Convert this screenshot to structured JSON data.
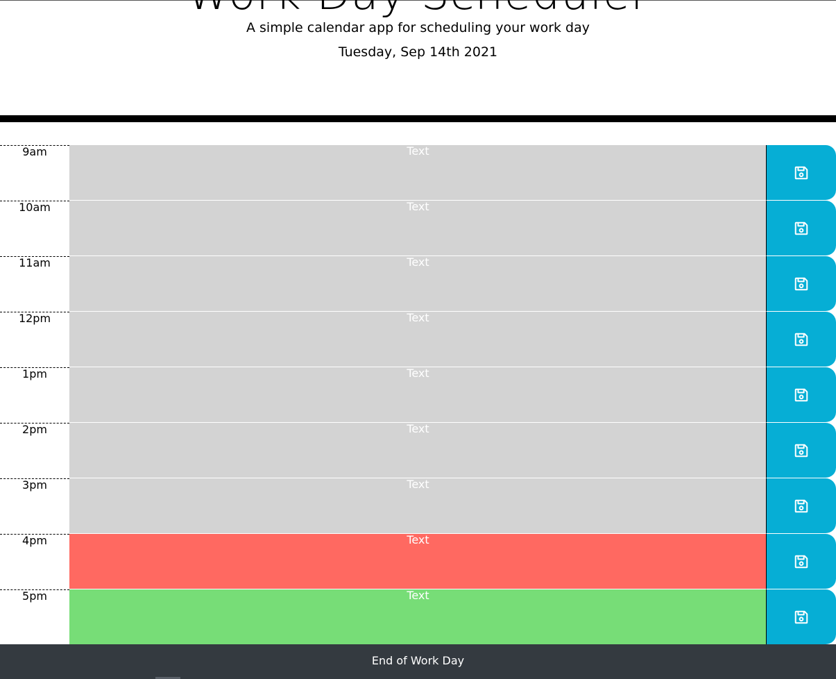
{
  "header": {
    "title": "Work Day Scheduler",
    "lead": "A simple calendar app for scheduling your work day",
    "current_day": "Tuesday, Sep 14th 2021"
  },
  "timeblocks": [
    {
      "hour": "9am",
      "placeholder": "Text",
      "status": "past"
    },
    {
      "hour": "10am",
      "placeholder": "Text",
      "status": "past"
    },
    {
      "hour": "11am",
      "placeholder": "Text",
      "status": "past"
    },
    {
      "hour": "12pm",
      "placeholder": "Text",
      "status": "past"
    },
    {
      "hour": "1pm",
      "placeholder": "Text",
      "status": "past"
    },
    {
      "hour": "2pm",
      "placeholder": "Text",
      "status": "past"
    },
    {
      "hour": "3pm",
      "placeholder": "Text",
      "status": "past"
    },
    {
      "hour": "4pm",
      "placeholder": "Text",
      "status": "present"
    },
    {
      "hour": "5pm",
      "placeholder": "Text",
      "status": "future"
    }
  ],
  "footer": {
    "text": "End of Work Day"
  },
  "colors": {
    "past": "#d3d3d3",
    "present": "#ff6961",
    "future": "#77dd77",
    "save_button": "#06aed5",
    "footer_bg": "#343a40"
  },
  "icons": {
    "save": "floppy-disk-icon"
  }
}
